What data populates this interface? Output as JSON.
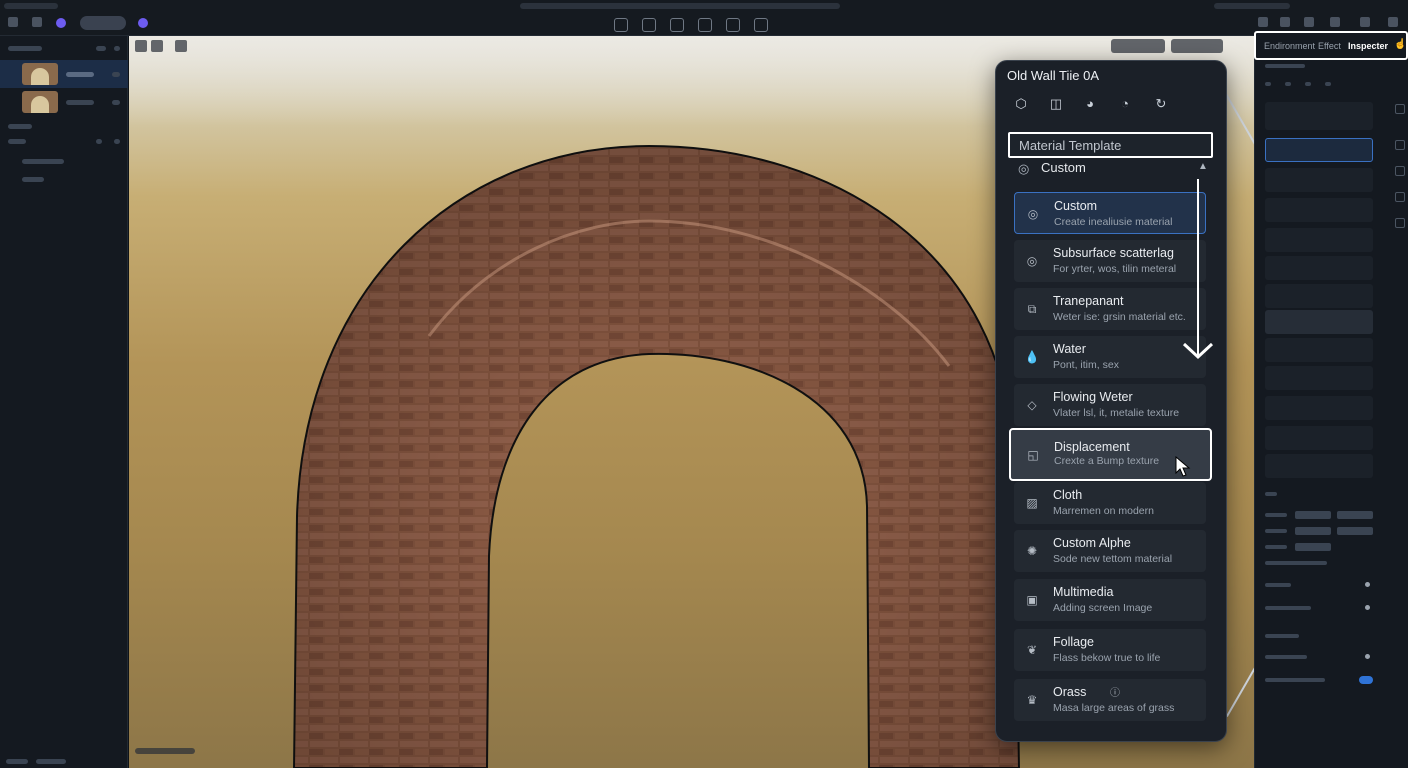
{
  "inspector_tabs": {
    "environment": "Endironment",
    "effect": "Effect",
    "inspector": "Inspecter"
  },
  "picker": {
    "title": "Old Wall Tiie 0A",
    "toolbar_icons": [
      "shape-icon",
      "texture-icon",
      "palette-icon",
      "palette-plus-icon",
      "refresh-icon"
    ],
    "template_placeholder": "Material Template",
    "selected_template": "Custom",
    "options": [
      {
        "name": "Custom",
        "desc": "Create inealiusie material",
        "icon": "custom-icon"
      },
      {
        "name": "Subsurface scatterlag",
        "desc": "For yrter, wos, tilin meteral",
        "icon": "subsurface-icon"
      },
      {
        "name": "Tranepanant",
        "desc": "Weter ise: grsin material etc.",
        "icon": "transparent-icon"
      },
      {
        "name": "Water",
        "desc": "Pont, itim, sex",
        "icon": "water-drop-icon"
      },
      {
        "name": "Flowing Weter",
        "desc": "Vlater lsl, it, metalie texture",
        "icon": "flowing-water-icon"
      },
      {
        "name": "Displacement",
        "desc": "Crexte a Bump texture",
        "icon": "displacement-icon"
      },
      {
        "name": "Cloth",
        "desc": "Marremen on modern",
        "icon": "cloth-icon"
      },
      {
        "name": "Custom Alphe",
        "desc": "Sode new tettom material",
        "icon": "sun-icon"
      },
      {
        "name": "Multimedia",
        "desc": "Adding screen Image",
        "icon": "image-icon"
      },
      {
        "name": "Follage",
        "desc": "Flass bekow true to life",
        "icon": "leaf-icon"
      },
      {
        "name": "Orass",
        "desc": "Masa large areas of grass",
        "icon": "grass-icon"
      }
    ]
  },
  "colors": {
    "accent": "#3a71c2",
    "panel": "#1b2028",
    "brick": "#8c5a43",
    "toggle": "#2f73d6"
  }
}
